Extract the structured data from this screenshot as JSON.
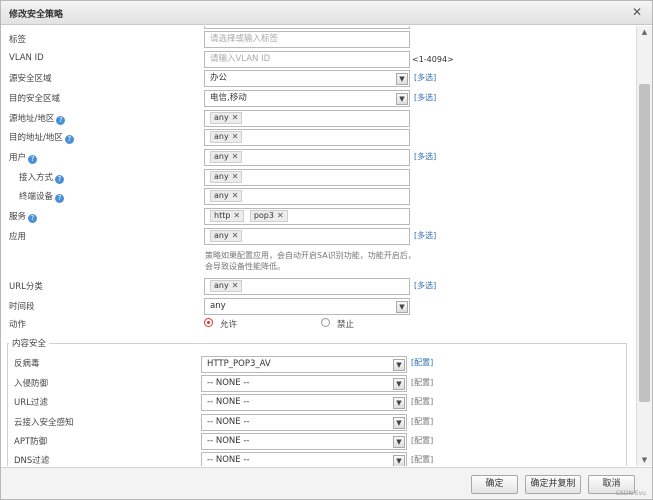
{
  "dialog": {
    "title": "修改安全策略"
  },
  "form": {
    "tag_label": "标签",
    "tag_placeholder": "请选择或输入标签",
    "vlan_label": "VLAN ID",
    "vlan_placeholder": "请输入VLAN ID",
    "vlan_range": "<1-4094>",
    "src_zone_label": "源安全区域",
    "src_zone_value": "办公",
    "dst_zone_label": "目的安全区域",
    "dst_zone_value": "电信,移动",
    "multi_select": "[多选]",
    "src_addr_label": "源地址/地区",
    "dst_addr_label": "目的地址/地区",
    "user_label": "用户",
    "access_label": "接入方式",
    "terminal_label": "终端设备",
    "service_label": "服务",
    "app_label": "应用",
    "any": "any",
    "service_tags": [
      "http",
      "pop3"
    ],
    "app_note": "策略如果配置应用，会自动开启SA识别功能，功能开启后，会导致设备性能降低。",
    "url_label": "URL分类",
    "time_label": "时间段",
    "time_value": "any",
    "action_label": "动作",
    "action_permit": "允许",
    "action_deny": "禁止"
  },
  "content_security": {
    "legend": "内容安全",
    "config_link": "[配置]",
    "rows": [
      {
        "label": "反病毒",
        "value": "HTTP_POP3_AV"
      },
      {
        "label": "入侵防御",
        "value": "-- NONE --"
      },
      {
        "label": "URL过滤",
        "value": "-- NONE --"
      },
      {
        "label": "云接入安全感知",
        "value": "-- NONE --"
      },
      {
        "label": "APT防御",
        "value": "-- NONE --"
      },
      {
        "label": "DNS过滤",
        "value": "-- NONE --"
      }
    ]
  },
  "footer": {
    "ok": "确定",
    "ok_copy": "确定并复制",
    "cancel": "取消",
    "watermark": "CSDN·Evu"
  },
  "icons": {
    "close": "close-icon",
    "help": "help-icon",
    "dropdown": "chevron-down-icon",
    "remove": "remove-tag-icon"
  }
}
